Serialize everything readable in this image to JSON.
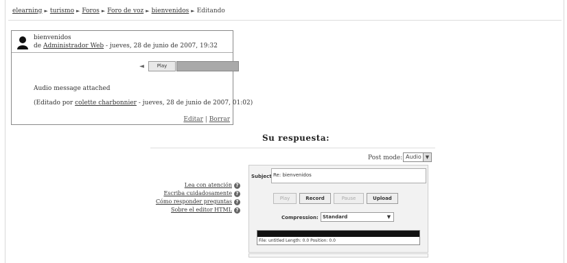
{
  "breadcrumb": {
    "items": [
      "elearning",
      "turismo",
      "Foros",
      "Foro de voz",
      "bienvenidos",
      "Editando"
    ],
    "separator": "►"
  },
  "post": {
    "subject": "bienvenidos",
    "by_prefix": "de",
    "author": "Administrador Web",
    "date": "- jueves, 28 de junio de 2007, 19:32",
    "play_label": "Play",
    "audio_message": "Audio message attached",
    "edited_prefix": "(Editado por",
    "edited_by": "colette charbonnier",
    "edited_date": "- jueves, 28 de junio de 2007, 01:02)",
    "edit_link": "Editar",
    "action_sep": "|",
    "delete_link": "Borrar"
  },
  "reply": {
    "title": "Su respuesta:",
    "post_mode_label": "Post mode:",
    "post_mode_value": "Audio"
  },
  "help_links": [
    "Lea con atención",
    "Escriba cuidadosamente",
    "Cómo responder preguntas",
    "Sobre el editor HTML"
  ],
  "recorder": {
    "subject_label": "Subject:",
    "subject_value": "Re: bienvenidos",
    "buttons": {
      "play": "Play",
      "record": "Record",
      "pause": "Pause",
      "upload": "Upload"
    },
    "compression_label": "Compression:",
    "compression_value": "Standard",
    "file_info": "File: untitled  Length: 0.0  Position: 0.0"
  },
  "icons": {
    "user": "user-silhouette-icon",
    "speaker": "speaker-icon",
    "help": "help-icon",
    "dropdown": "dropdown-arrow-icon"
  }
}
